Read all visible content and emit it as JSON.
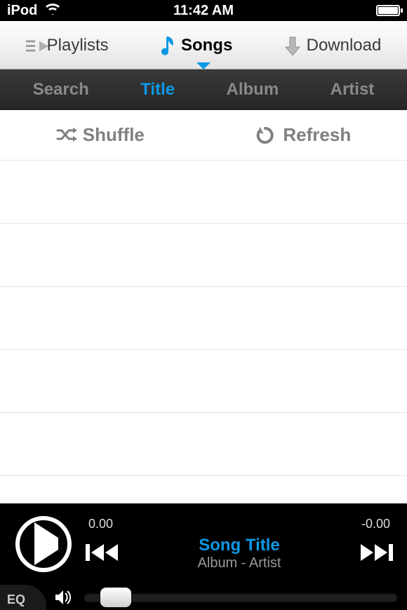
{
  "statusbar": {
    "device": "iPod",
    "time": "11:42 AM"
  },
  "toolbar": {
    "playlists": "Playlists",
    "songs": "Songs",
    "download": "Download",
    "active": "songs"
  },
  "sortbar": {
    "search": "Search",
    "title": "Title",
    "album": "Album",
    "artist": "Artist",
    "active": "title"
  },
  "actions": {
    "shuffle": "Shuffle",
    "refresh": "Refresh"
  },
  "player": {
    "elapsed": "0.00",
    "remaining": "-0.00",
    "song_title": "Song Title",
    "album_artist": "Album - Artist",
    "eq_label": "EQ",
    "volume_percent": 10
  },
  "colors": {
    "accent": "#0d98e6"
  }
}
